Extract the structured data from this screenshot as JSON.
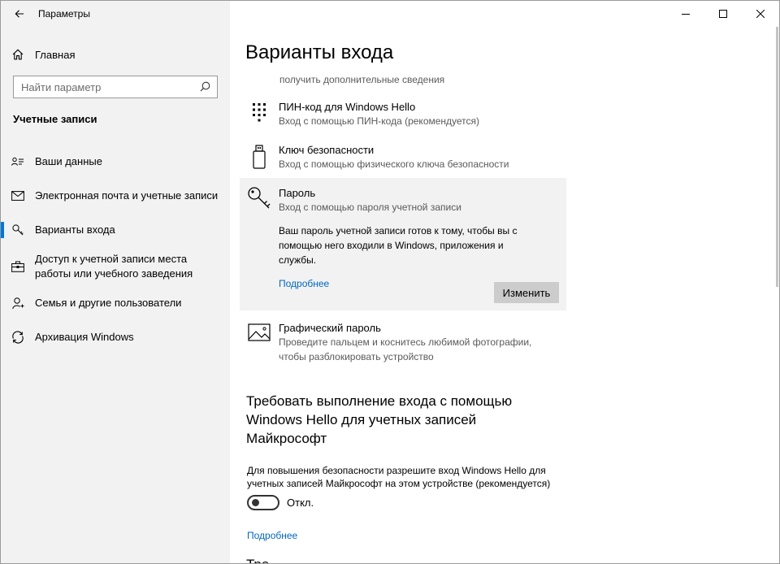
{
  "window": {
    "title": "Параметры"
  },
  "sidebar": {
    "home_label": "Главная",
    "search_placeholder": "Найти параметр",
    "section_header": "Учетные записи",
    "items": [
      {
        "label": "Ваши данные",
        "icon": "person-card-icon"
      },
      {
        "label": "Электронная почта и учетные записи",
        "icon": "mail-icon"
      },
      {
        "label": "Варианты входа",
        "icon": "key-icon",
        "selected": true
      },
      {
        "label": "Доступ к учетной записи места работы или учебного заведения",
        "icon": "briefcase-icon"
      },
      {
        "label": "Семья и другие пользователи",
        "icon": "person-add-icon"
      },
      {
        "label": "Архивация Windows",
        "icon": "sync-icon"
      }
    ]
  },
  "main": {
    "page_title": "Варианты входа",
    "partial_option_subtitle": "получить дополнительные сведения",
    "options": {
      "pin": {
        "title": "ПИН-код для Windows Hello",
        "subtitle": "Вход с помощью ПИН-кода (рекомендуется)"
      },
      "security_key": {
        "title": "Ключ безопасности",
        "subtitle": "Вход с помощью физического ключа безопасности"
      },
      "password": {
        "title": "Пароль",
        "subtitle": "Вход с помощью пароля учетной записи",
        "description": "Ваш пароль учетной записи готов к тому, чтобы вы с помощью него входили в Windows, приложения и службы.",
        "link": "Подробнее",
        "button": "Изменить"
      },
      "picture_password": {
        "title": "Графический пароль",
        "subtitle": "Проведите пальцем и коснитесь любимой фотографии, чтобы разблокировать устройство"
      }
    },
    "require_hello": {
      "heading": "Требовать выполнение входа с помощью Windows Hello для учетных записей Майкрософт",
      "description": "Для повышения безопасности разрешите вход Windows Hello для учетных записей Майкрософт на этом устройстве (рекомендуется)",
      "toggle_state": "Откл.",
      "toggle_on": false,
      "link": "Подробнее"
    },
    "next_heading_partial": "Тре"
  }
}
